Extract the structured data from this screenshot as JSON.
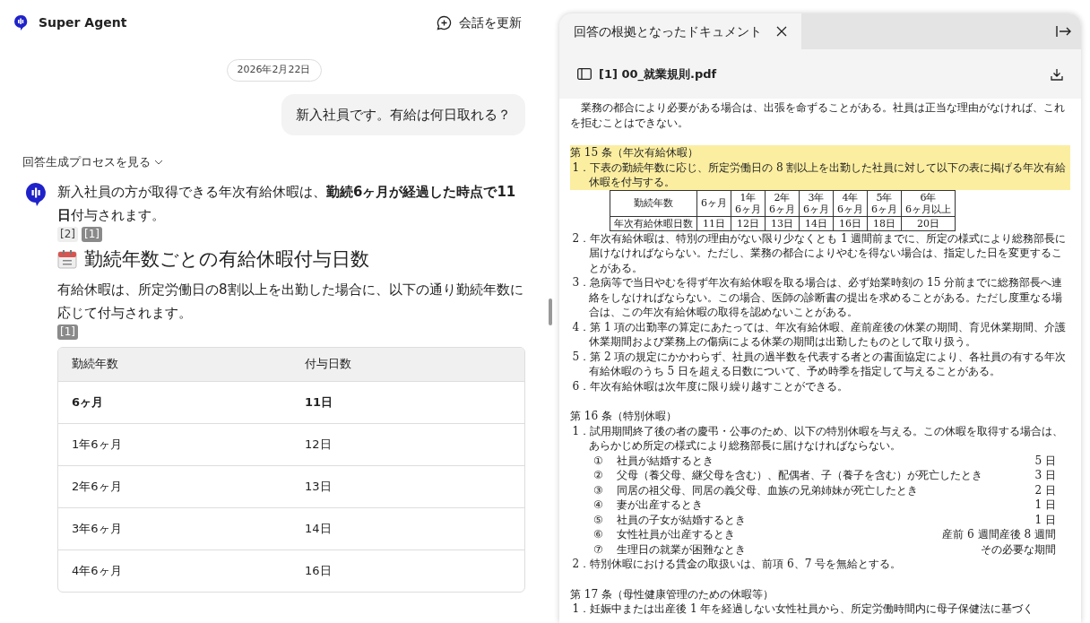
{
  "app": {
    "name": "Super Agent"
  },
  "refresh_button": {
    "label": "会話を更新"
  },
  "conversation": {
    "date": "2026年2月22日",
    "user_message": "新入社員です。有給は何日取れる？",
    "process_toggle": {
      "label": "回答生成プロセスを見る",
      "expanded": false
    },
    "answer": {
      "summary": "新入社員の方が取得できる年次有給休暇は、**勤続6ヶ月が経過した時点で11日**付与されます。",
      "summary_citations": [
        {
          "label": "[2]",
          "selected": false
        },
        {
          "label": "[1]",
          "selected": true
        }
      ],
      "heading": "勤続年数ごとの有給休暇付与日数",
      "intro": "有給休暇は、所定労働日の8割以上を出勤した場合に、以下の通り勤続年数に応じて付与されます。",
      "intro_citations": [
        {
          "label": "[1]",
          "selected": true
        }
      ],
      "table": {
        "columns": [
          "勤続年数",
          "付与日数"
        ],
        "rows": [
          {
            "cells": [
              "6ヶ月",
              "11日"
            ],
            "highlighted": true
          },
          {
            "cells": [
              "1年6ヶ月",
              "12日"
            ],
            "highlighted": false
          },
          {
            "cells": [
              "2年6ヶ月",
              "13日"
            ],
            "highlighted": false
          },
          {
            "cells": [
              "3年6ヶ月",
              "14日"
            ],
            "highlighted": false
          },
          {
            "cells": [
              "4年6ヶ月",
              "16日"
            ],
            "highlighted": false
          }
        ]
      }
    }
  },
  "document_panel": {
    "tab": {
      "title": "回答の根拠となったドキュメント",
      "selected": true
    },
    "file_name": "[1] 00_就業規則.pdf",
    "blocks": [
      {
        "kind": "paragraph",
        "text": "業務の都合により必要がある場合は、出張を命ずることがある。社員は正当な理由がなければ、これを拒むことはできない。",
        "highlighted": false
      },
      {
        "kind": "heading",
        "text": "第 15 条（年次有給休暇）",
        "highlighted": true
      },
      {
        "kind": "clause",
        "text": "1．下表の勤続年数に応じ、所定労働日の 8 割以上を出勤した社員に対して以下の表に掲げる年次有給休暇を付与する。",
        "highlighted": true
      },
      {
        "kind": "table",
        "rows": [
          [
            "勤続年数",
            "6ヶ月",
            "1年\n6ヶ月",
            "2年\n6ヶ月",
            "3年\n6ヶ月",
            "4年\n6ヶ月",
            "5年\n6ヶ月",
            "6年\n6ヶ月以上"
          ],
          [
            "年次有給休暇日数",
            "11日",
            "12日",
            "13日",
            "14日",
            "16日",
            "18日",
            "20日"
          ]
        ]
      },
      {
        "kind": "clause",
        "text": "2．年次有給休暇は、特別の理由がない限り少なくとも 1 週間前までに、所定の様式により総務部長に届けなければならない。ただし、業務の都合によりやむを得ない場合は、指定した日を変更することがある。",
        "highlighted": false
      },
      {
        "kind": "clause",
        "text": "3．急病等で当日やむを得ず年次有給休暇を取る場合は、必ず始業時刻の 15 分前までに総務部長へ連絡をしなければならない。この場合、医師の診断書の提出を求めることがある。ただし度重なる場合は、この年次有給休暇の取得を認めないことがある。",
        "highlighted": false
      },
      {
        "kind": "clause",
        "text": "4．第 1 項の出勤率の算定にあたっては、年次有給休暇、産前産後の休業の期間、育児休業期間、介護休業期間および業務上の傷病による休業の期間は出勤したものとして取り扱う。",
        "highlighted": false
      },
      {
        "kind": "clause",
        "text": "5．第 2 項の規定にかかわらず、社員の過半数を代表する者との書面協定により、各社員の有する年次有給休暇のうち 5 日を超える日数について、予め時季を指定して与えることがある。",
        "highlighted": false
      },
      {
        "kind": "clause",
        "text": "6．年次有給休暇は次年度に限り繰り越すことができる。",
        "highlighted": false
      },
      {
        "kind": "heading",
        "text": "第 16 条（特別休暇）",
        "highlighted": false
      },
      {
        "kind": "clause",
        "text": "1．試用期間終了後の者の慶弔・公事のため、以下の特別休暇を与える。この休暇を取得する場合は、あらかじめ所定の様式により総務部長に届けなければならない。",
        "highlighted": false
      },
      {
        "kind": "item",
        "mark": "①",
        "text": "社員が結婚するとき",
        "value": "5 日"
      },
      {
        "kind": "item",
        "mark": "②",
        "text": "父母（養父母、継父母を含む）、配偶者、子（養子を含む）が死亡したとき",
        "value": "3 日"
      },
      {
        "kind": "item",
        "mark": "③",
        "text": "同居の祖父母、同居の義父母、血族の兄弟姉妹が死亡したとき",
        "value": "2 日"
      },
      {
        "kind": "item",
        "mark": "④",
        "text": "妻が出産するとき",
        "value": "1 日"
      },
      {
        "kind": "item",
        "mark": "⑤",
        "text": "社員の子女が結婚するとき",
        "value": "1 日"
      },
      {
        "kind": "item",
        "mark": "⑥",
        "text": "女性社員が出産するとき",
        "value": "産前 6 週間産後 8 週間"
      },
      {
        "kind": "item",
        "mark": "⑦",
        "text": "生理日の就業が困難なとき",
        "value": "その必要な期間"
      },
      {
        "kind": "clause",
        "text": "2．特別休暇における賃金の取扱いは、前項 6、7 号を無給とする。",
        "highlighted": false
      },
      {
        "kind": "heading",
        "text": "第 17 条（母性健康管理のための休暇等）",
        "highlighted": false
      },
      {
        "kind": "clause",
        "text": "1．妊娠中または出産後 1 年を経過しない女性社員から、所定労働時間内に母子保健法に基づく",
        "highlighted": false
      }
    ]
  }
}
